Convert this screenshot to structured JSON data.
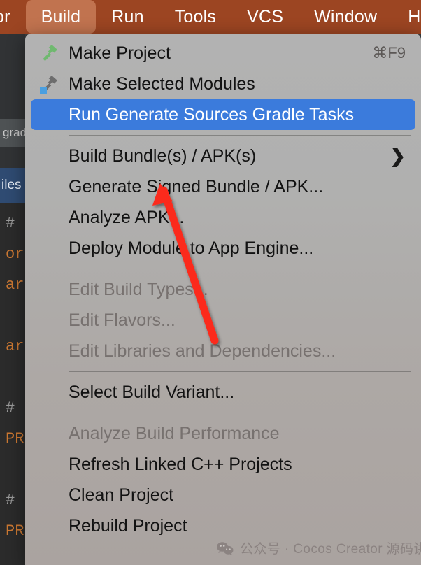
{
  "menubar": {
    "items": [
      {
        "label": "or",
        "active": false,
        "clipped": true
      },
      {
        "label": "Build",
        "active": true,
        "clipped": false
      },
      {
        "label": "Run",
        "active": false,
        "clipped": false
      },
      {
        "label": "Tools",
        "active": false,
        "clipped": false
      },
      {
        "label": "VCS",
        "active": false,
        "clipped": false
      },
      {
        "label": "Window",
        "active": false,
        "clipped": false
      },
      {
        "label": "H",
        "active": false,
        "clipped": false
      }
    ],
    "background_color": "#9c4522",
    "active_color": "#c1734f"
  },
  "build_menu": {
    "highlight_color": "#3b7bdc",
    "items": [
      {
        "label": "Make Project",
        "shortcut": "⌘F9",
        "icon": "hammer-green-icon",
        "state": "enabled"
      },
      {
        "label": "Make Selected Modules",
        "shortcut": "",
        "icon": "hammer-module-icon",
        "state": "enabled"
      },
      {
        "label": "Run Generate Sources Gradle Tasks",
        "shortcut": "",
        "icon": "",
        "state": "highlighted"
      },
      {
        "separator": true
      },
      {
        "label": "Build Bundle(s) / APK(s)",
        "shortcut": "",
        "icon": "",
        "state": "enabled",
        "submenu": true
      },
      {
        "label": "Generate Signed Bundle / APK...",
        "shortcut": "",
        "icon": "",
        "state": "enabled"
      },
      {
        "label": "Analyze APK...",
        "shortcut": "",
        "icon": "",
        "state": "enabled"
      },
      {
        "label": "Deploy Module to App Engine...",
        "shortcut": "",
        "icon": "",
        "state": "enabled"
      },
      {
        "separator": true
      },
      {
        "label": "Edit Build Types...",
        "shortcut": "",
        "icon": "",
        "state": "disabled"
      },
      {
        "label": "Edit Flavors...",
        "shortcut": "",
        "icon": "",
        "state": "disabled"
      },
      {
        "label": "Edit Libraries and Dependencies...",
        "shortcut": "",
        "icon": "",
        "state": "disabled"
      },
      {
        "separator": true
      },
      {
        "label": "Select Build Variant...",
        "shortcut": "",
        "icon": "",
        "state": "enabled"
      },
      {
        "separator": true
      },
      {
        "label": "Analyze Build Performance",
        "shortcut": "",
        "icon": "",
        "state": "disabled"
      },
      {
        "label": "Refresh Linked C++ Projects",
        "shortcut": "",
        "icon": "",
        "state": "enabled"
      },
      {
        "label": "Clean Project",
        "shortcut": "",
        "icon": "",
        "state": "enabled"
      },
      {
        "label": "Rebuild Project",
        "shortcut": "",
        "icon": "",
        "state": "enabled"
      }
    ],
    "submenu_arrow_glyph": "❯"
  },
  "ide_background": {
    "tab_label": "grad",
    "selected_tab_label": "iles",
    "code_lines": [
      {
        "text": "#",
        "kind": "comment"
      },
      {
        "text": "or",
        "kind": "key"
      },
      {
        "text": "ar",
        "kind": "key"
      },
      {
        "text": "",
        "kind": "comment"
      },
      {
        "text": "ar",
        "kind": "key"
      },
      {
        "text": "",
        "kind": "comment"
      },
      {
        "text": "#",
        "kind": "comment"
      },
      {
        "text": "PR",
        "kind": "key"
      },
      {
        "text": "",
        "kind": "comment"
      },
      {
        "text": "#",
        "kind": "comment"
      },
      {
        "text": "PR",
        "kind": "key"
      }
    ]
  },
  "annotation": {
    "arrow_color": "#fb2a1a",
    "points_to": "Build Bundle(s) / APK(s)"
  },
  "watermark": {
    "icon": "wechat-icon",
    "text": "公众号 · Cocos Creator 源码讲解"
  }
}
